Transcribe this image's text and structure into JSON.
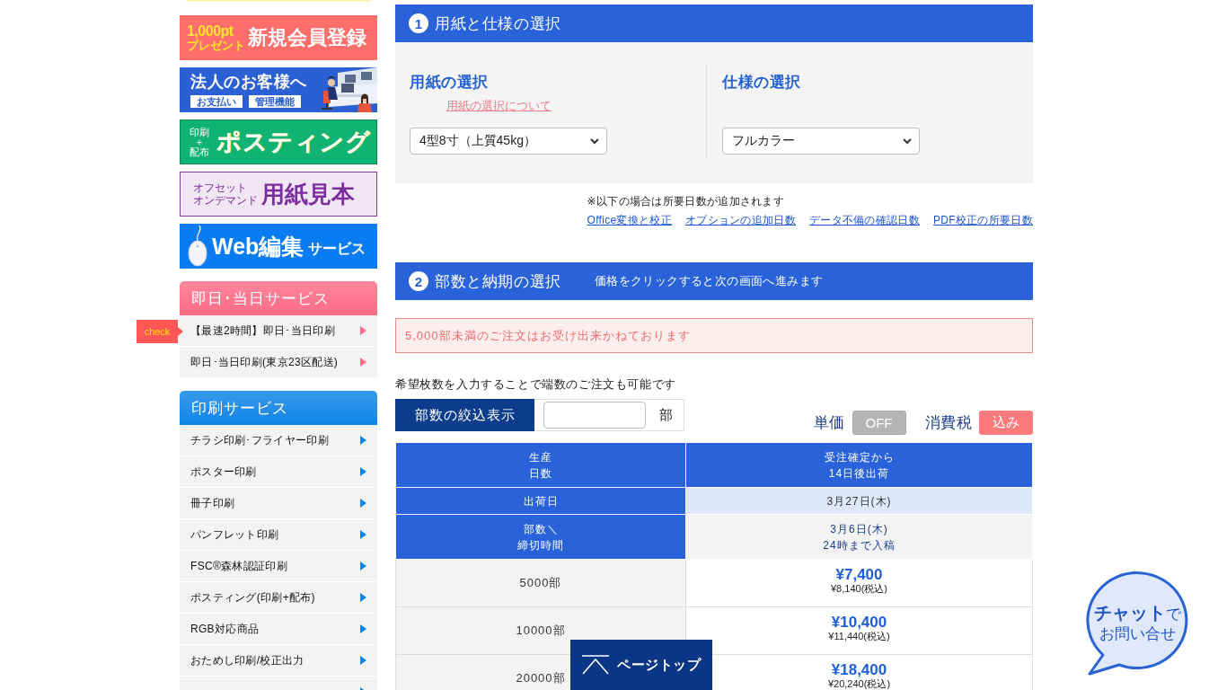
{
  "sidebar": {
    "banners": [
      {
        "kind": "signup",
        "points": "1,000pt",
        "sub": "プレゼント",
        "title": "新規会員登録"
      },
      {
        "kind": "business",
        "title": "法人のお客様へ",
        "tags": [
          "お支払い",
          "管理機能"
        ]
      },
      {
        "kind": "posting",
        "side_lines": [
          "印刷",
          "+",
          "配布"
        ],
        "title": "ポスティング"
      },
      {
        "kind": "samples",
        "lines": [
          "オフセット",
          "オンデマンド"
        ],
        "title": "用紙見本"
      },
      {
        "kind": "web",
        "title": "Web編集",
        "sub": "サービス"
      }
    ],
    "sections": [
      {
        "title": "即日･当日サービス",
        "color": "#ff6b86",
        "items": [
          {
            "label": "【最速2時間】即日･当日印刷",
            "badge": "check"
          },
          {
            "label": "即日･当日印刷(東京23区配送)"
          }
        ]
      },
      {
        "title": "印刷サービス",
        "color": "#0a84e6",
        "items": [
          {
            "label": "チラシ印刷･フライヤー印刷"
          },
          {
            "label": "ポスター印刷"
          },
          {
            "label": "冊子印刷"
          },
          {
            "label": "パンフレット印刷"
          },
          {
            "label": "FSC®森林認証印刷"
          },
          {
            "label": "ポスティング(印刷+配布)"
          },
          {
            "label": "RGB対応商品"
          },
          {
            "label": "おためし印刷/校正出力"
          }
        ],
        "more_below": true
      }
    ]
  },
  "step1": {
    "number": "1",
    "title": "用紙と仕様の選択",
    "columns": [
      {
        "heading": "用紙の選択",
        "link": "用紙の選択について",
        "select": "4型8寸（上質45kg）"
      },
      {
        "heading": "仕様の選択",
        "select": "フルカラー"
      }
    ],
    "note": "※以下の場合は所要日数が追加されます",
    "links": [
      "Office変換と校正",
      "オプションの追加日数",
      "データ不備の確認日数",
      "PDF校正の所要日数"
    ]
  },
  "step2": {
    "number": "2",
    "title": "部数と納期の選択",
    "hint": "価格をクリックすると次の画面へ進みます",
    "alert": "5,000部未満のご注文はお受け出来かねております",
    "instructions": "希望枚数を入力することで端数のご注文も可能です",
    "filter_button": "部数の絞込表示",
    "unit": "部",
    "toggles": [
      {
        "label": "単価",
        "value": "OFF",
        "on": false
      },
      {
        "label": "消費税",
        "value": "込み",
        "on": true
      }
    ],
    "table": {
      "rows": [
        {
          "kind": "head",
          "label": [
            "生産",
            "日数"
          ],
          "value": [
            "受注確定から",
            "14日後出荷"
          ]
        },
        {
          "kind": "date",
          "label": [
            "出荷日"
          ],
          "value": [
            "3月27日(木)"
          ]
        },
        {
          "kind": "deadline",
          "label": [
            "部数＼",
            "締切時間"
          ],
          "value": [
            "3月6日(木)",
            "24時まで入稿"
          ]
        }
      ],
      "prices": [
        {
          "quantity": "5000部",
          "price": "¥7,400",
          "price_with_tax": "¥8,140(税込)"
        },
        {
          "quantity": "10000部",
          "price": "¥10,400",
          "price_with_tax": "¥11,440(税込)"
        },
        {
          "quantity": "20000部",
          "price": "¥18,400",
          "price_with_tax": "¥20,240(税込)"
        }
      ]
    }
  },
  "page_top": "ページトップ",
  "chat": {
    "line1": "**チャット**で",
    "line2": "お問い合せ"
  }
}
